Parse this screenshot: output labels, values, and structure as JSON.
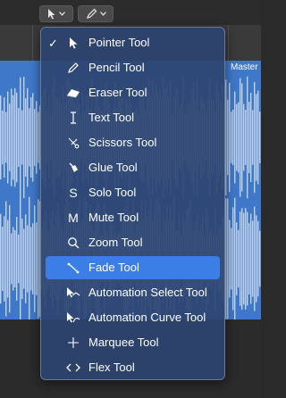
{
  "toolbar": {
    "left_tool": "pointer",
    "right_tool": "pencil"
  },
  "region": {
    "name": "Master"
  },
  "menu": {
    "items": [
      {
        "label": "Pointer Tool",
        "checked": true,
        "icon": "pointer-icon"
      },
      {
        "label": "Pencil Tool",
        "checked": false,
        "icon": "pencil-icon"
      },
      {
        "label": "Eraser Tool",
        "checked": false,
        "icon": "eraser-icon"
      },
      {
        "label": "Text Tool",
        "checked": false,
        "icon": "text-cursor-icon"
      },
      {
        "label": "Scissors Tool",
        "checked": false,
        "icon": "scissors-icon"
      },
      {
        "label": "Glue Tool",
        "checked": false,
        "icon": "glue-icon"
      },
      {
        "label": "Solo Tool",
        "checked": false,
        "icon": "solo-icon"
      },
      {
        "label": "Mute Tool",
        "checked": false,
        "icon": "mute-icon"
      },
      {
        "label": "Zoom Tool",
        "checked": false,
        "icon": "zoom-icon"
      },
      {
        "label": "Fade Tool",
        "checked": false,
        "icon": "fade-icon",
        "highlighted": true
      },
      {
        "label": "Automation Select Tool",
        "checked": false,
        "icon": "automation-select-icon"
      },
      {
        "label": "Automation Curve Tool",
        "checked": false,
        "icon": "automation-curve-icon"
      },
      {
        "label": "Marquee Tool",
        "checked": false,
        "icon": "marquee-icon"
      },
      {
        "label": "Flex Tool",
        "checked": false,
        "icon": "flex-icon"
      }
    ],
    "check_glyph": "✓",
    "solo_glyph": "S",
    "mute_glyph": "M"
  },
  "colors": {
    "highlight": "#3a7ee6",
    "region": "#3f78c9",
    "menu_bg": "#2c4470"
  }
}
